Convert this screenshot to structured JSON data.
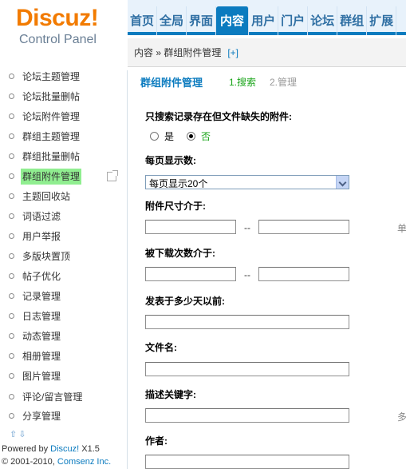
{
  "logo": {
    "word": "Discuz",
    "bang": "!",
    "subtitle": "Control Panel"
  },
  "topnav": [
    "首页",
    "全局",
    "界面",
    "内容",
    "用户",
    "门户",
    "论坛",
    "群组",
    "扩展"
  ],
  "topnav_active": "内容",
  "breadcrumb": {
    "path": "内容 » 群组附件管理",
    "add": "[+]"
  },
  "sidebar": {
    "items": [
      "论坛主题管理",
      "论坛批量删帖",
      "论坛附件管理",
      "群组主题管理",
      "群组批量删帖",
      "群组附件管理",
      "主题回收站",
      "词语过滤",
      "用户举报",
      "多版块置顶",
      "帖子优化",
      "记录管理",
      "日志管理",
      "动态管理",
      "相册管理",
      "图片管理",
      "评论/留言管理",
      "分享管理"
    ],
    "active_index": 5,
    "scroll_arrows": "⇧⇩"
  },
  "footer": {
    "powered_prefix": "Powered by ",
    "powered_brand": "Discuz!",
    "powered_version": " X1.5",
    "copyright_prefix": "© 2001-2010, ",
    "copyright_company": "Comsenz Inc."
  },
  "main": {
    "title": "群组附件管理",
    "step1": "1.搜索",
    "step2": "2.管理",
    "missing_label": "只搜索记录存在但文件缺失的附件:",
    "missing_yes": "是",
    "missing_no": "否",
    "missing_value": "否",
    "perpage_label": "每页显示数:",
    "perpage_value": "每页显示20个",
    "size_label": "附件尺寸介于:",
    "size_sep": "--",
    "size_hint": "单",
    "downloads_label": "被下载次数介于:",
    "downloads_sep": "--",
    "days_label": "发表于多少天以前:",
    "filename_label": "文件名:",
    "keywords_label": "描述关键字:",
    "keywords_hint": "多",
    "author_label": "作者:"
  },
  "colors": {
    "brand_orange": "#f27b00",
    "accent_blue": "#0b7bbf",
    "active_green": "#90ee90",
    "step_green": "#1aa51a"
  }
}
